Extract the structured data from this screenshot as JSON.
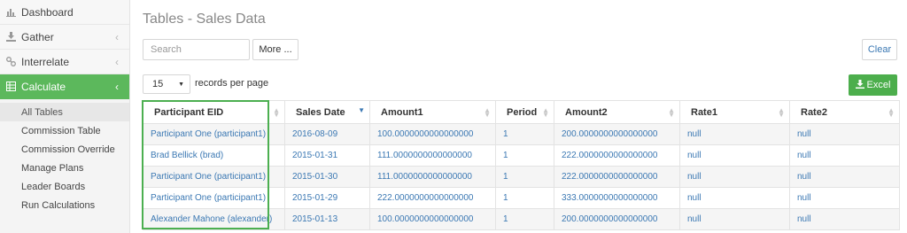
{
  "sidebar": {
    "items": [
      {
        "label": "Dashboard"
      },
      {
        "label": "Gather",
        "chevron": "‹"
      },
      {
        "label": "Interrelate",
        "chevron": "‹"
      },
      {
        "label": "Calculate",
        "chevron": "‹"
      }
    ],
    "submenu": [
      "All Tables",
      "Commission Table",
      "Commission Override",
      "Manage Plans",
      "Leader Boards",
      "Run Calculations"
    ]
  },
  "page": {
    "title": "Tables - Sales Data"
  },
  "toolbar": {
    "search_placeholder": "Search",
    "more_label": "More ...",
    "clear_label": "Clear",
    "page_size": "15",
    "records_per_page": "records per page",
    "excel_label": "Excel"
  },
  "table": {
    "columns": [
      "Participant EID",
      "Sales Date",
      "Amount1",
      "Period",
      "Amount2",
      "Rate1",
      "Rate2"
    ],
    "rows": [
      [
        "Participant One (participant1)",
        "2016-08-09",
        "100.0000000000000000",
        "1",
        "200.0000000000000000",
        "null",
        "null"
      ],
      [
        "Brad Bellick (brad)",
        "2015-01-31",
        "111.0000000000000000",
        "1",
        "222.0000000000000000",
        "null",
        "null"
      ],
      [
        "Participant One (participant1)",
        "2015-01-30",
        "111.0000000000000000",
        "1",
        "222.0000000000000000",
        "null",
        "null"
      ],
      [
        "Participant One (participant1)",
        "2015-01-29",
        "222.0000000000000000",
        "1",
        "333.0000000000000000",
        "null",
        "null"
      ],
      [
        "Alexander Mahone (alexander)",
        "2015-01-13",
        "100.0000000000000000",
        "1",
        "200.0000000000000000",
        "null",
        "null"
      ]
    ]
  },
  "colors": {
    "accent_green": "#5cb85c",
    "link_blue": "#3b78b3",
    "highlight_green": "#4caf50"
  },
  "icons": [
    "bar-chart-icon",
    "download-icon",
    "link-icon",
    "table-icon",
    "download-icon",
    "sort-icon"
  ]
}
